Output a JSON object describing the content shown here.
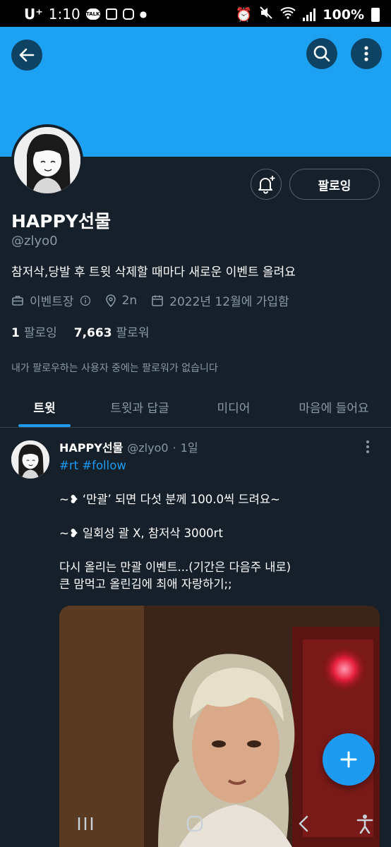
{
  "status_bar": {
    "carrier": "U⁺",
    "time": "1:10",
    "talk_label": "TALK",
    "battery": "100%"
  },
  "profile": {
    "name": "HAPPY선물",
    "handle": "@zlyo0",
    "bio": "참저삭,당발 후 트윗 삭제할 때마다 새로운 이벤트 올려요",
    "category": "이벤트장",
    "location": "2n",
    "joined": "2022년 12월에 가입함",
    "following_count": "1",
    "following_label": "팔로잉",
    "followers_count": "7,663",
    "followers_label": "팔로워",
    "no_followers_note": "내가 팔로우하는 사용자 중에는 팔로워가 없습니다",
    "following_button": "팔로잉"
  },
  "tabs": [
    {
      "label": "트윗",
      "active": true
    },
    {
      "label": "트윗과 답글",
      "active": false
    },
    {
      "label": "미디어",
      "active": false
    },
    {
      "label": "마음에 들어요",
      "active": false
    }
  ],
  "tweet": {
    "name": "HAPPY선물",
    "handle": "@zlyo0",
    "separator": "·",
    "time": "1일",
    "hashtags": "#rt #follow",
    "line1": "~❥ ‘만괄’ 되면 다섯 분께 100.0씩 드려요~",
    "line2": "~❥ 일회성 괄 X, 참저삭 3000rt",
    "line3": "다시 올리는 만괄 이벤트...(기간은 다음주 내로)",
    "line4": "큰 맘먹고 올린김에 최애 자랑하기;;"
  },
  "colors": {
    "background": "#15202b",
    "banner": "#1da1f2",
    "accent": "#1d9bf0",
    "muted": "#8b98a5"
  },
  "icons": [
    "back-arrow-icon",
    "search-icon",
    "more-vertical-icon",
    "bell-plus-icon",
    "briefcase-icon",
    "info-icon",
    "location-pin-icon",
    "calendar-icon",
    "plus-icon",
    "recents-icon",
    "home-icon",
    "back-icon",
    "accessibility-icon"
  ]
}
